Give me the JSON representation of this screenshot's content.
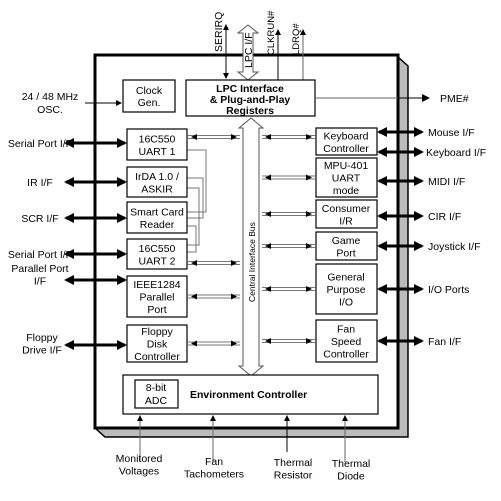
{
  "top_signals": {
    "serirq": "SERIRQ",
    "lpc_if": "LPC I/F",
    "clkrun": "CLKRUN#",
    "ldrq": "LDRQ#"
  },
  "clock_gen": [
    "Clock",
    "Gen."
  ],
  "lpc_block": [
    "LPC Interface",
    "& Plug-and-Play",
    "Registers"
  ],
  "osc": [
    "24 / 48 MHz",
    "OSC."
  ],
  "pme": "PME#",
  "central_bus": "Central Interface Bus",
  "left_blocks": [
    [
      "16C550",
      "UART 1"
    ],
    [
      "IrDA 1.0 /",
      "ASKIR"
    ],
    [
      "Smart Card",
      "Reader"
    ],
    [
      "16C550",
      "UART 2"
    ],
    [
      "IEEE1284",
      "Parallel",
      "Port"
    ],
    [
      "Floppy",
      "Disk",
      "Controller"
    ]
  ],
  "left_ifaces": [
    [
      "Serial Port I/F"
    ],
    [
      "IR I/F"
    ],
    [
      "SCR I/F"
    ],
    [
      "Serial Port I/F"
    ],
    [
      "Parallel Port",
      "I/F"
    ],
    [
      "Floppy",
      "Drive I/F"
    ]
  ],
  "right_blocks": [
    [
      "Keyboard",
      "Controller"
    ],
    [
      "MPU-401",
      "UART",
      "mode"
    ],
    [
      "Consumer",
      "I/R"
    ],
    [
      "Game",
      "Port"
    ],
    [
      "General",
      "Purpose",
      "I/O"
    ],
    [
      "Fan",
      "Speed",
      "Controller"
    ]
  ],
  "right_ifaces": [
    "Mouse I/F",
    "Keyboard I/F",
    "MIDI I/F",
    "CIR I/F",
    "Joystick I/F",
    "I/O Ports",
    "Fan I/F"
  ],
  "env_controller": "Environment Controller",
  "adc": [
    "8-bit",
    "ADC"
  ],
  "bottom_inputs": [
    [
      "Monitored",
      "Voltages"
    ],
    [
      "Fan",
      "Tachometers"
    ],
    [
      "Thermal",
      "Resistor"
    ],
    [
      "Thermal",
      "Diode"
    ]
  ]
}
